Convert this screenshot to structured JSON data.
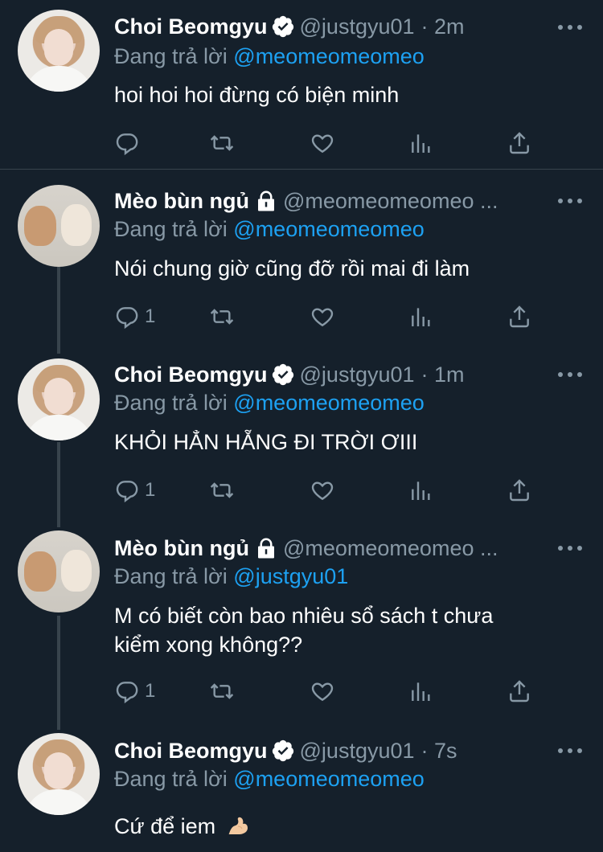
{
  "reply_prefix": "Đang trả lời",
  "tweets": [
    {
      "author": "Choi Beomgyu",
      "verified": true,
      "handle": "@justgyu01",
      "time": "· 2m",
      "reply_to": "@meomeomeomeo",
      "text": "hoi hoi hoi đừng có biện minh",
      "reply_count": ""
    },
    {
      "author": "Mèo bùn ngủ",
      "protected": true,
      "handle": "@meomeomeomeo ...",
      "reply_to": "@meomeomeomeo",
      "text": "Nói chung giờ cũng đỡ rồi mai đi làm",
      "reply_count": "1"
    },
    {
      "author": "Choi Beomgyu",
      "verified": true,
      "handle": "@justgyu01",
      "time": "· 1m",
      "reply_to": "@meomeomeomeo",
      "text": "KHỎI HẲN HẴNG ĐI TRỜI ƠIII",
      "reply_count": "1"
    },
    {
      "author": "Mèo bùn ngủ",
      "protected": true,
      "handle": "@meomeomeomeo ...",
      "reply_to": "@justgyu01",
      "text_line1": "M có biết còn bao nhiêu sổ sách t chưa",
      "text_line2": "kiểm xong không??",
      "reply_count": "1"
    },
    {
      "author": "Choi Beomgyu",
      "verified": true,
      "handle": "@justgyu01",
      "time": "· 7s",
      "reply_to": "@meomeomeomeo",
      "text": "Cứ để iem",
      "emoji": "flexed-biceps"
    }
  ],
  "colors": {
    "background": "#15202b",
    "muted": "#8899a6",
    "mention": "#1da1f2",
    "divider": "#38444d"
  }
}
